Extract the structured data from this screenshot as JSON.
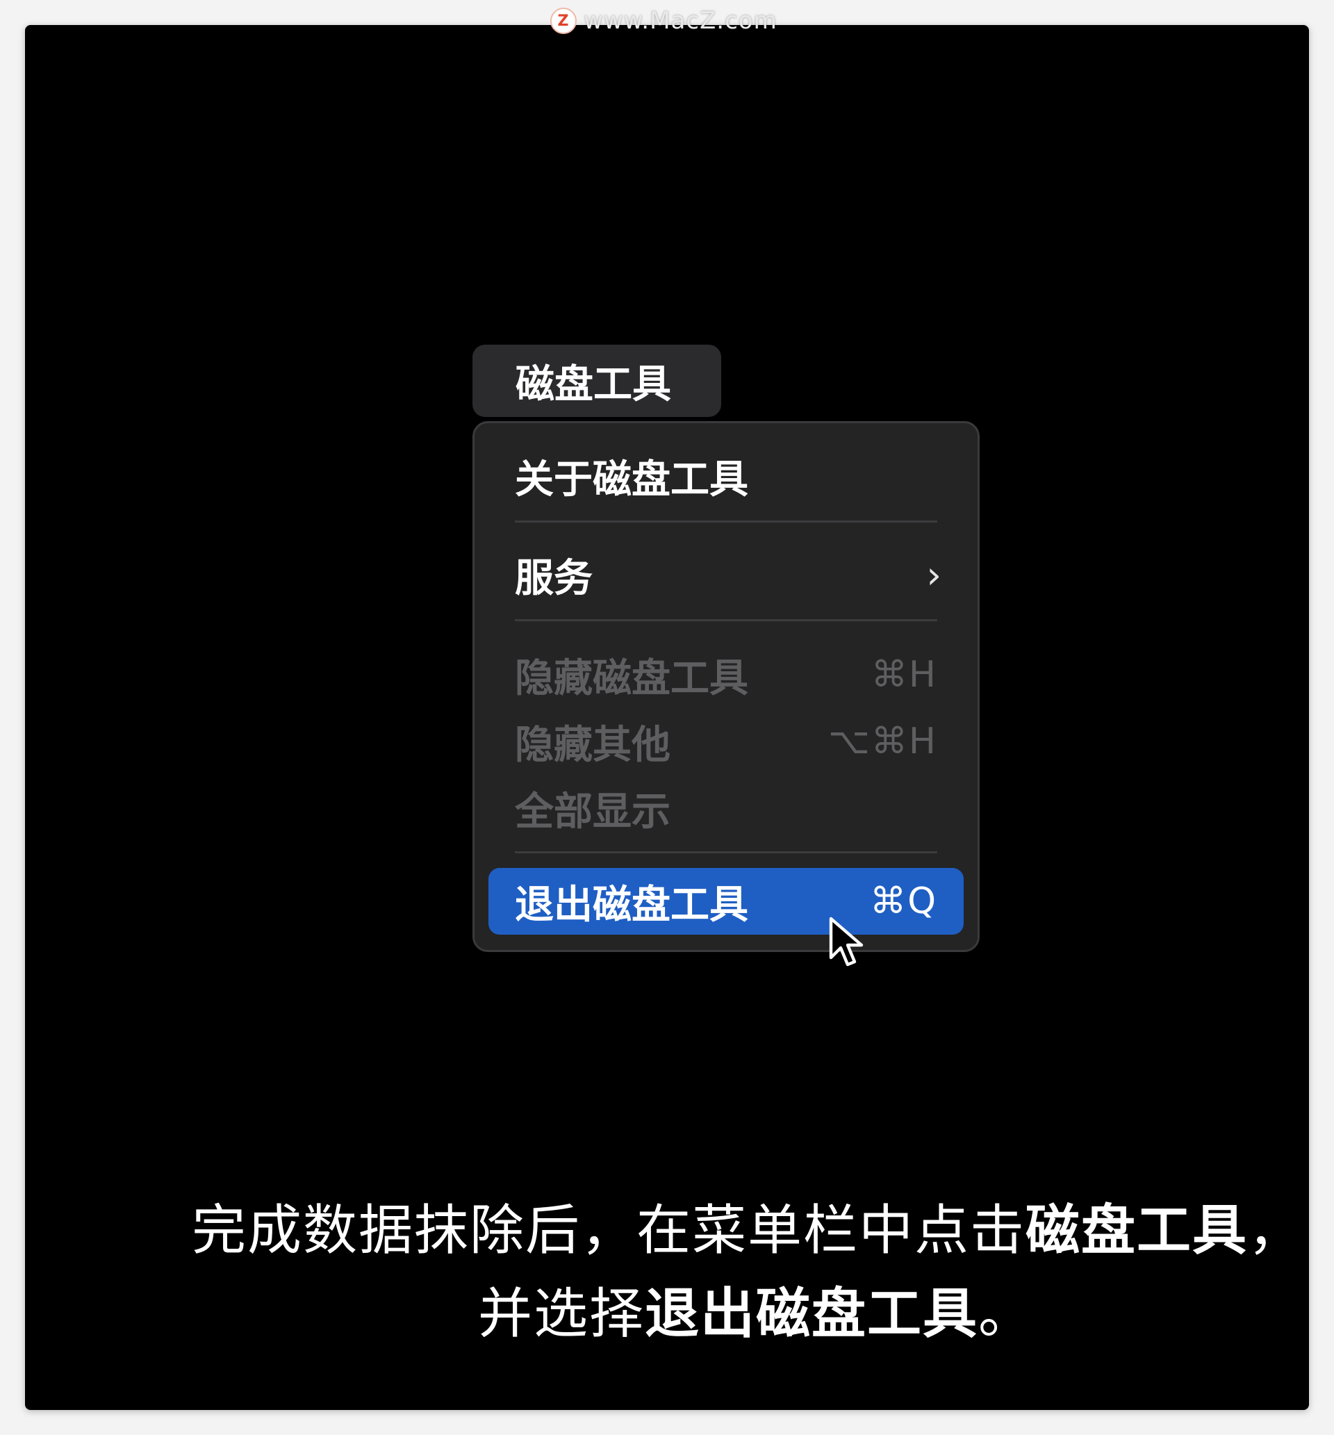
{
  "watermark": {
    "logo_letter": "Z",
    "text": "www.MacZ.com"
  },
  "menubar": {
    "app_title": "磁盘工具"
  },
  "menu": {
    "about": "关于磁盘工具",
    "services": "服务",
    "services_chevron": "›",
    "hide": "隐藏磁盘工具",
    "hide_shortcut": "⌘H",
    "hide_others": "隐藏其他",
    "hide_others_shortcut": "⌥⌘H",
    "show_all": "全部显示",
    "quit": "退出磁盘工具",
    "quit_shortcut": "⌘Q"
  },
  "caption": {
    "line1_prefix": "完成数据抹除后，在菜单栏中点击",
    "line1_bold": "磁盘工具",
    "line1_suffix": "，",
    "line2_prefix": "并选择",
    "line2_bold": "退出磁盘工具",
    "line2_suffix": "。"
  },
  "colors": {
    "selection_blue": "#1f5fc4",
    "menu_bg": "#242425",
    "disabled_text": "#5e5e60"
  }
}
